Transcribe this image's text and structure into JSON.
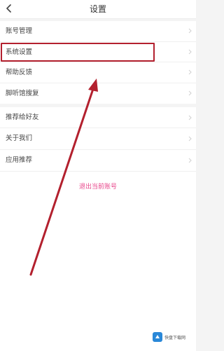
{
  "header": {
    "title": "设置",
    "back_icon": "chevron-left-icon"
  },
  "settings_group_1": [
    {
      "label": "账号管理"
    },
    {
      "label": "系统设置"
    },
    {
      "label": "帮助反馈"
    },
    {
      "label": "脚听馆搜复"
    }
  ],
  "settings_group_2": [
    {
      "label": "推荐给好友"
    },
    {
      "label": "关于我们"
    },
    {
      "label": "应用推荐"
    }
  ],
  "logout": {
    "label": "退出当前账号"
  },
  "annotation": {
    "color": "#b3202e"
  },
  "watermark": {
    "text": "快盘下载网"
  },
  "colors": {
    "accent": "#e8478b",
    "annotation": "#b3202e",
    "background": "#f4f4f4"
  }
}
